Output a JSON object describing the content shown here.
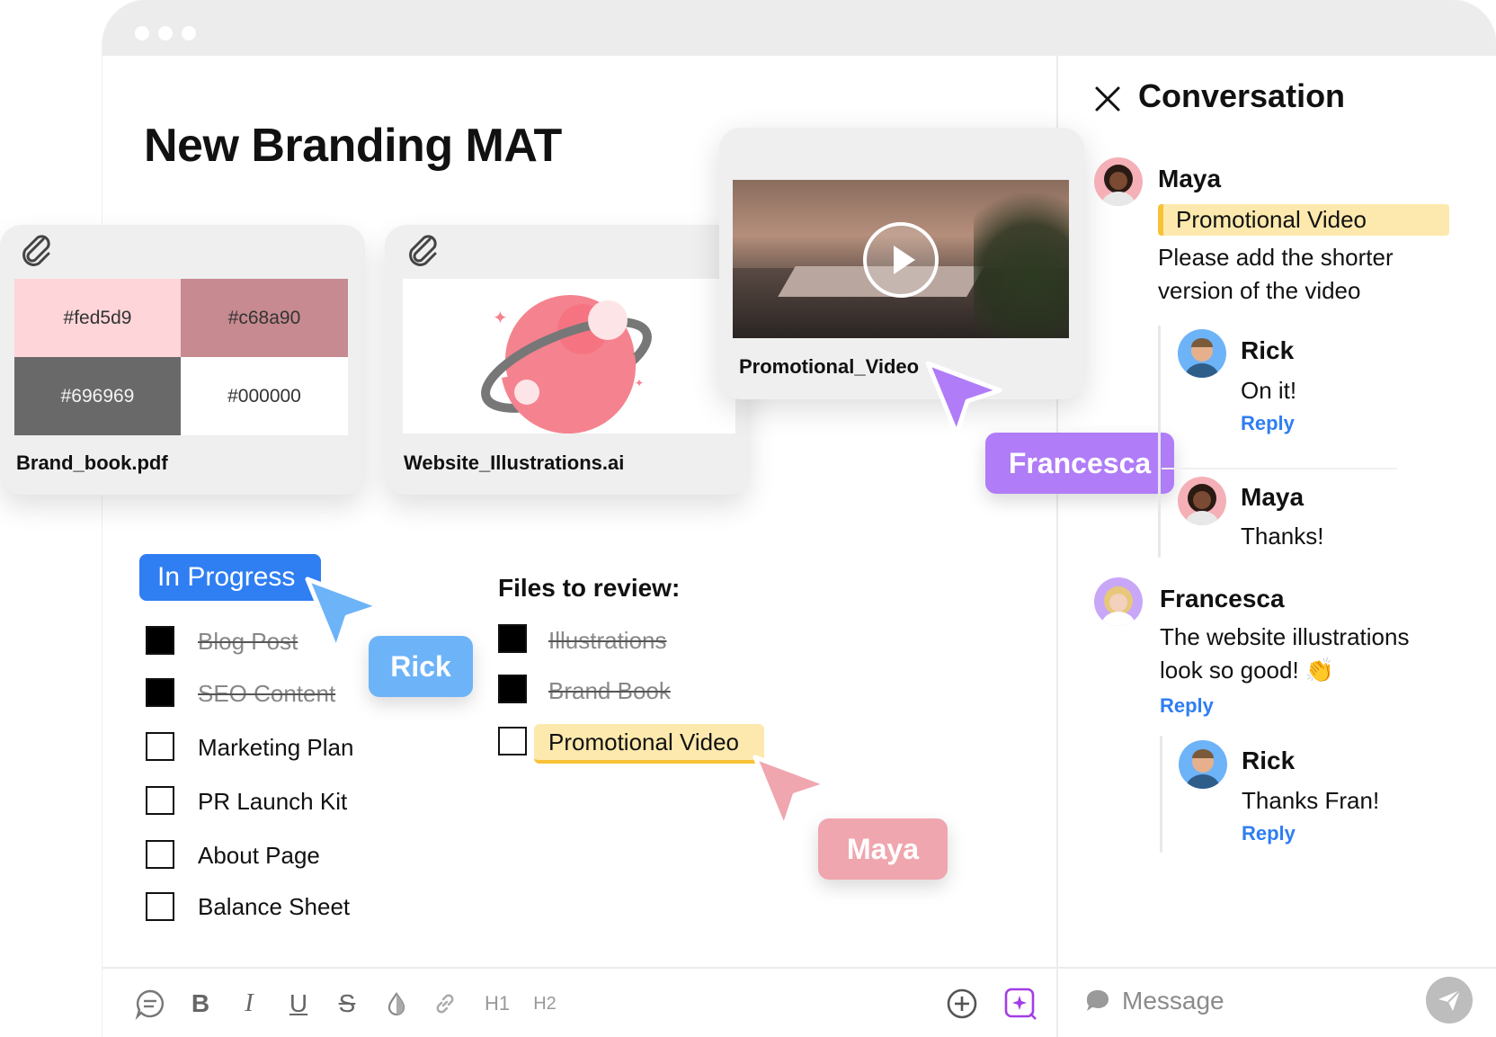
{
  "page_title": "New Branding MAT",
  "files": {
    "brand_book": {
      "name": "Brand_book.pdf",
      "swatches": [
        {
          "label": "#fed5d9",
          "color": "#fed5d9",
          "text_color": "#333333"
        },
        {
          "label": "#c68a90",
          "color": "#c68a90",
          "text_color": "#333333"
        },
        {
          "label": "#696969",
          "color": "#696969",
          "text_color": "#f4f4f4"
        },
        {
          "label": "#000000",
          "color": "#ffffff",
          "text_color": "#333333"
        }
      ]
    },
    "illustrations": {
      "name": "Website_Illustrations.ai"
    },
    "video": {
      "name": "Promotional_Video"
    }
  },
  "tasks": {
    "status": "In Progress",
    "items": [
      {
        "label": "Blog Post",
        "checked": true
      },
      {
        "label": "SEO Content",
        "checked": true
      },
      {
        "label": "Marketing Plan",
        "checked": false
      },
      {
        "label": "PR Launch Kit",
        "checked": false
      },
      {
        "label": "About Page",
        "checked": false
      },
      {
        "label": "Balance Sheet",
        "checked": false
      }
    ]
  },
  "review": {
    "heading": "Files to review:",
    "items": [
      {
        "label": "Illustrations",
        "checked": true
      },
      {
        "label": "Brand Book",
        "checked": true
      },
      {
        "label": "Promotional Video",
        "checked": false
      }
    ]
  },
  "cursors": {
    "rick": {
      "name": "Rick",
      "color": "#6db3f8"
    },
    "francesca": {
      "name": "Francesca",
      "color": "#b07cf7"
    },
    "maya": {
      "name": "Maya",
      "color": "#f0a6ae"
    }
  },
  "toolbar": {
    "h1": "H1",
    "h2": "H2",
    "bold": "B",
    "italic": "I",
    "underline": "U",
    "strike": "S"
  },
  "conversation": {
    "title": "Conversation",
    "reply_label": "Reply",
    "comment1": {
      "author": "Maya",
      "quote": "Promotional Video",
      "text_line1": "Please add the shorter",
      "text_line2": "version of the video"
    },
    "reply1": {
      "author": "Rick",
      "text": "On it!"
    },
    "reply2": {
      "author": "Maya",
      "text": "Thanks!"
    },
    "comment2": {
      "author": "Francesca",
      "text_line1": "The website illustrations",
      "text_line2": "look so good! 👏"
    },
    "reply3": {
      "author": "Rick",
      "text": "Thanks Fran!"
    },
    "message_placeholder": "Message"
  },
  "colors": {
    "accent_blue": "#2f7ef2",
    "highlight_yellow": "#fde9ad",
    "highlight_border": "#f7c237"
  }
}
